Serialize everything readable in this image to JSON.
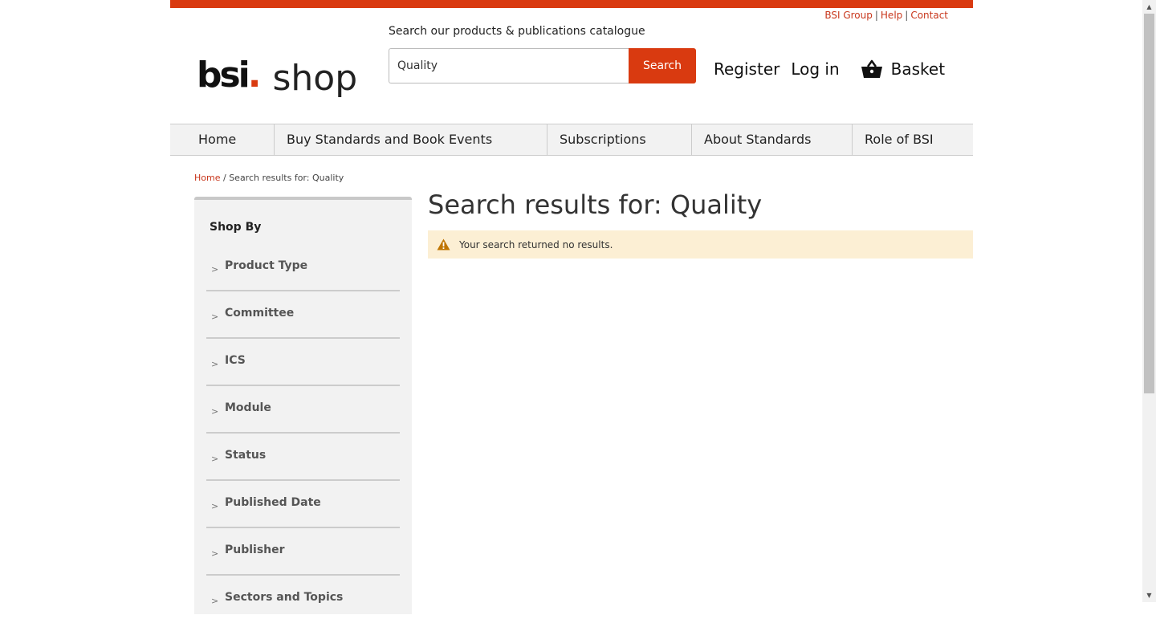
{
  "colors": {
    "brand": "#d93a10",
    "link": "#c8361b",
    "alert_bg": "#fcefd4",
    "alert_icon": "#c07500"
  },
  "utility_links": [
    "BSI Group",
    "Help",
    "Contact"
  ],
  "logo": {
    "brand": "bsi",
    "dot": ".",
    "name": "shop"
  },
  "search": {
    "label": "Search our products & publications catalogue",
    "value": "Quality",
    "button": "Search"
  },
  "account": {
    "register": "Register",
    "login": "Log in",
    "basket": "Basket",
    "basket_icon": "basket-icon"
  },
  "nav": [
    "Home",
    "Buy Standards and Book Events",
    "Subscriptions",
    "About Standards",
    "Role of BSI"
  ],
  "breadcrumb": {
    "home": "Home",
    "separator": " / ",
    "current": "Search results for: Quality"
  },
  "sidebar": {
    "title": "Shop By",
    "chevron": ">",
    "items": [
      "Product Type",
      "Committee",
      "ICS",
      "Module",
      "Status",
      "Published Date",
      "Publisher",
      "Sectors and Topics"
    ]
  },
  "results": {
    "title": "Search results for: Quality",
    "message": "Your search returned no results.",
    "icon": "warning-icon"
  }
}
